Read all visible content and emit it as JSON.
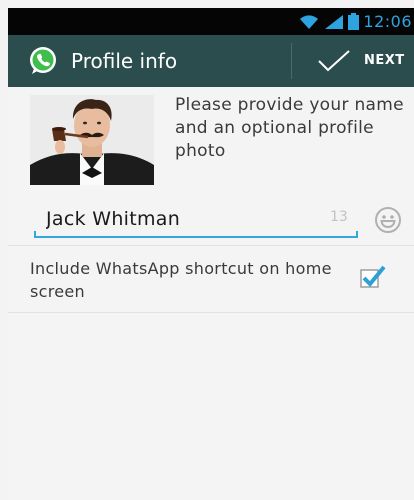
{
  "status_bar": {
    "time": "12:06",
    "icons": [
      "wifi-icon",
      "signal-icon",
      "battery-icon"
    ]
  },
  "action_bar": {
    "title": "Profile info",
    "app_icon": "whatsapp-icon",
    "next_label": "NEXT",
    "next_icon": "check-icon"
  },
  "profile": {
    "photo": "profile-photo",
    "prompt": "Please provide your name and an optional profile photo",
    "name_value": "Jack Whitman",
    "name_remaining": "13",
    "emoji_icon": "smiley-icon"
  },
  "shortcut": {
    "label": "Include WhatsApp shortcut on home screen",
    "checked": true
  },
  "colors": {
    "action_bar": "#2c4d4e",
    "accent": "#33a7d9",
    "whatsapp_green": "#3fbe4f"
  }
}
